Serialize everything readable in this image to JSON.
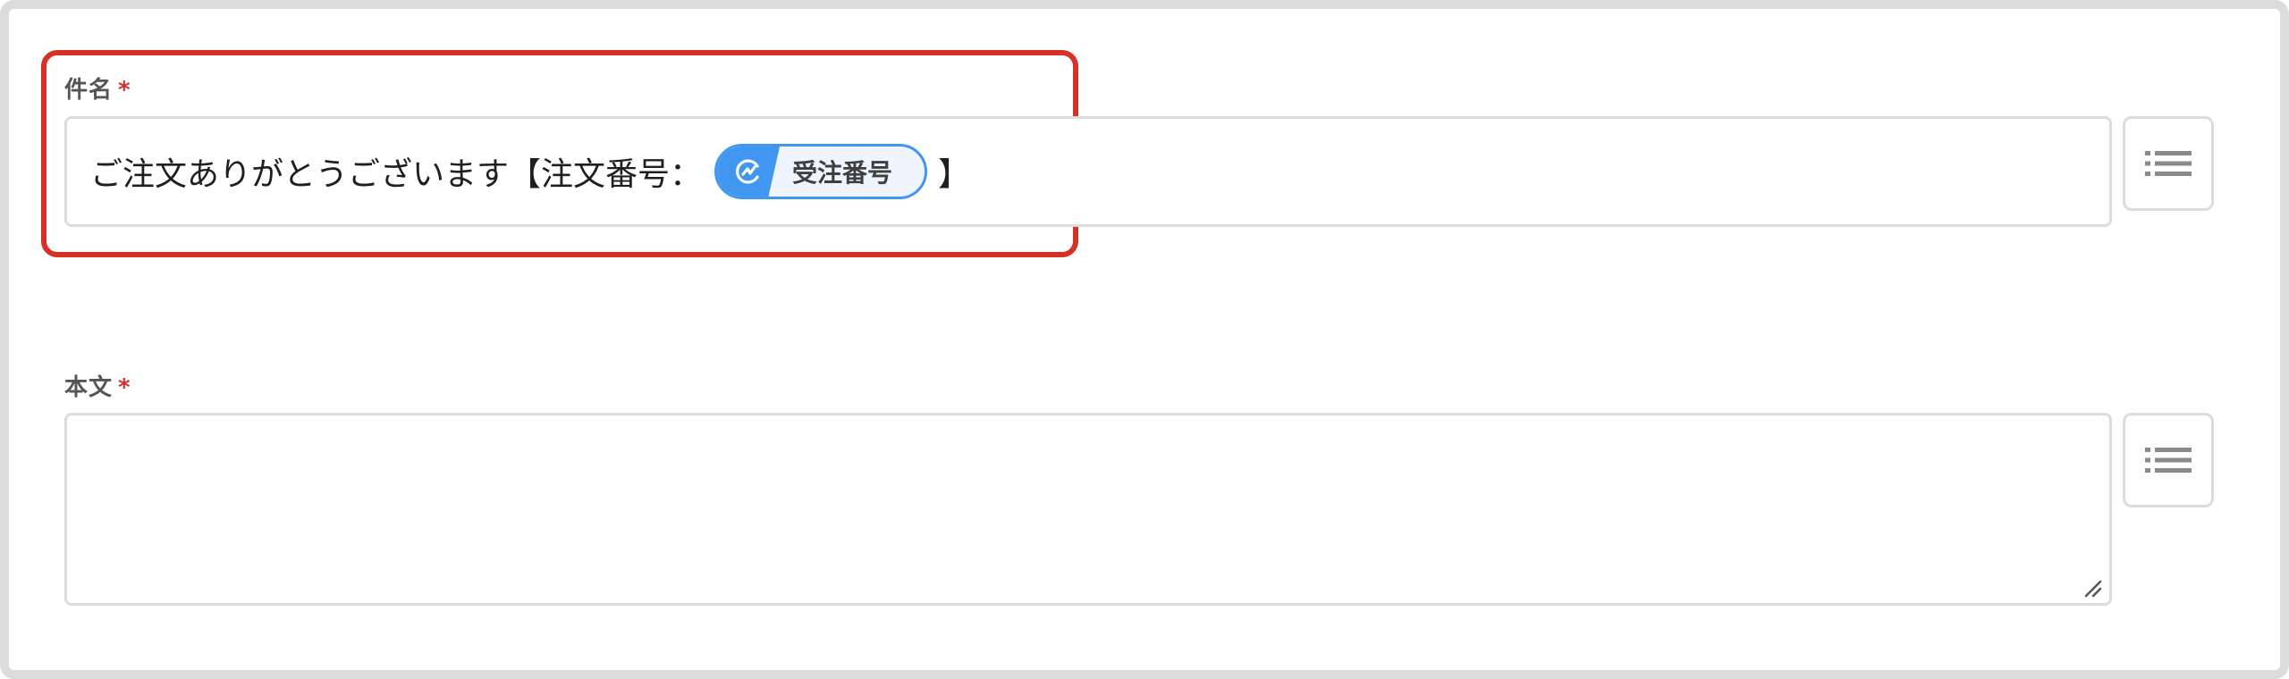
{
  "subject_field": {
    "label": "件名",
    "required_mark": "*",
    "text_before": "ご注文ありがとうございます【注文番号：",
    "variable_chip": {
      "label": "受注番号",
      "icon": "variable-icon"
    },
    "text_after": "】",
    "insert_button_icon": "list-icon"
  },
  "body_field": {
    "label": "本文",
    "required_mark": "*",
    "value": "",
    "insert_button_icon": "list-icon"
  },
  "colors": {
    "highlight": "#d93025",
    "chip_accent": "#4196f0",
    "required": "#d32f2f"
  }
}
